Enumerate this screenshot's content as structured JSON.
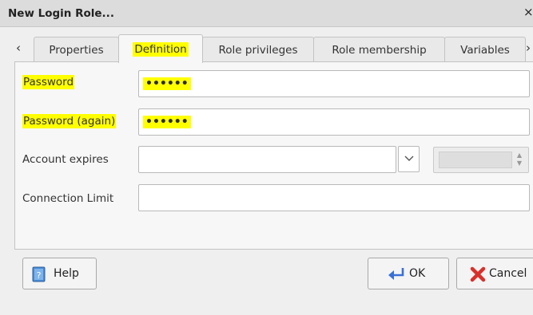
{
  "window": {
    "title": "New Login Role...",
    "close_glyph": "×"
  },
  "tabs": [
    {
      "label": "Properties",
      "active": false
    },
    {
      "label": "Definition",
      "active": true
    },
    {
      "label": "Role privileges",
      "active": false
    },
    {
      "label": "Role membership",
      "active": false
    },
    {
      "label": "Variables",
      "active": false
    }
  ],
  "tab_scroll": {
    "left_glyph": "‹",
    "right_glyph": "›"
  },
  "form": {
    "password_label": "Password",
    "password_value": "••••••",
    "password_again_label": "Password (again)",
    "password_again_value": "••••••",
    "account_expires_label": "Account expires",
    "account_expires_value": "",
    "connection_limit_label": "Connection Limit",
    "connection_limit_value": ""
  },
  "buttons": {
    "help": "Help",
    "ok": "OK",
    "cancel": "Cancel"
  },
  "colors": {
    "highlight": "#ffff00",
    "ok_icon": "#3a6fd8",
    "cancel_icon": "#d9302b",
    "help_icon": "#4a8ed6"
  }
}
